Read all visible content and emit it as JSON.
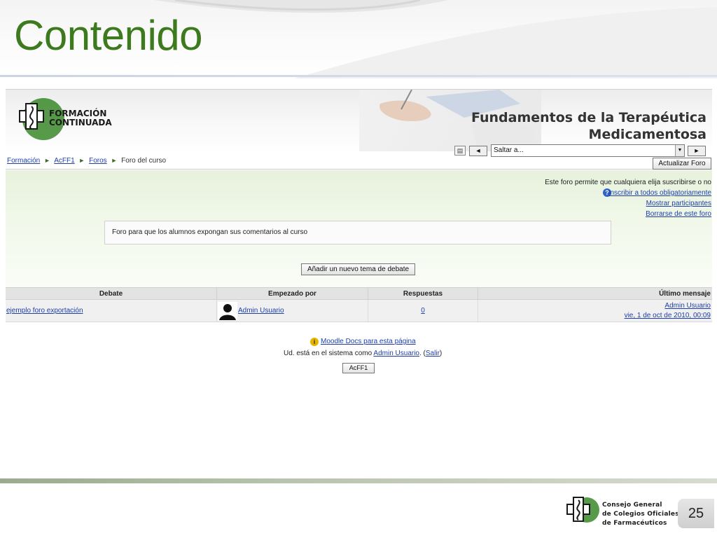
{
  "slide": {
    "title": "Contenido",
    "page_number": "25",
    "footer_org": [
      "Consejo General",
      "de Colegios Oficiales",
      "de Farmacéuticos"
    ]
  },
  "banner": {
    "logo_text": [
      "FORMACIÓN",
      "CONTINUADA"
    ],
    "course_title": [
      "Fundamentos de la Terapéutica",
      "Medicamentosa"
    ]
  },
  "nav": {
    "breadcrumb": [
      "Formación",
      "AcFF1",
      "Foros",
      "Foro del curso"
    ],
    "separator": "►",
    "prev_label": "◄",
    "next_label": "►",
    "jump_placeholder": "Saltar a...",
    "update_button": "Actualizar Foro"
  },
  "forum": {
    "subscription_note": "Este foro permite que cualquiera elija suscribirse o no",
    "links": [
      "Inscribir a todos obligatoriamente",
      "Mostrar participantes",
      "Borrarse de este foro"
    ],
    "intro": "Foro para que los alumnos expongan sus comentarios al curso",
    "add_topic_button": "Añadir un nuevo tema de debate",
    "table": {
      "headers": [
        "Debate",
        "Empezado por",
        "Respuestas",
        "Último mensaje"
      ],
      "rows": [
        {
          "debate": "ejemplo foro exportación",
          "started_by": "Admin Usuario",
          "replies": "0",
          "last_author": "Admin Usuario",
          "last_date": "vie, 1 de oct de 2010, 00:09"
        }
      ]
    }
  },
  "footer": {
    "docs_link": "Moodle Docs para esta página",
    "login_prefix": "Ud. está en el sistema como",
    "login_user": "Admin Usuario",
    "logout_label": "Salir",
    "course_button": "AcFF1"
  },
  "colors": {
    "title_green": "#3d7a1e",
    "link_blue": "#1f3fa8",
    "logo_green": "#3a8a2a"
  }
}
